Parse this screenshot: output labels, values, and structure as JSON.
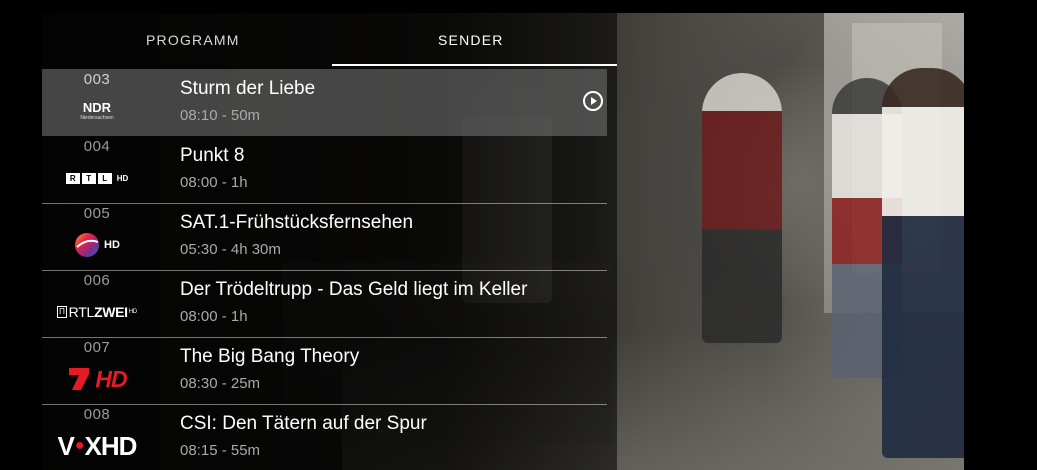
{
  "tabs": {
    "programm": "PROGRAMM",
    "sender": "SENDER",
    "active": "SENDER"
  },
  "channels": [
    {
      "number": "003",
      "logo": "NDR",
      "logo_sub": "Niedersachsen",
      "title": "Sturm der Liebe",
      "time": "08:10 - 50m",
      "selected": true
    },
    {
      "number": "004",
      "logo": "RTL",
      "logo_suffix": "HD",
      "title": "Punkt 8",
      "time": "08:00 - 1h",
      "selected": false
    },
    {
      "number": "005",
      "logo": "SAT.1",
      "logo_suffix": "HD",
      "title": "SAT.1-Frühstücksfernsehen",
      "time": "05:30 - 4h 30m",
      "selected": false
    },
    {
      "number": "006",
      "logo": "RTLZWEI",
      "logo_suffix": "HD",
      "title": "Der Trödeltrupp - Das Geld liegt im Keller",
      "time": "08:00 - 1h",
      "selected": false
    },
    {
      "number": "007",
      "logo": "7",
      "logo_suffix": "HD",
      "title": "The Big Bang Theory",
      "time": "08:30 - 25m",
      "selected": false
    },
    {
      "number": "008",
      "logo": "VOX",
      "logo_suffix": "HD",
      "title": "CSI: Den Tätern auf der Spur",
      "time": "08:15 - 55m",
      "selected": false
    }
  ],
  "colors": {
    "accent_red": "#e31b23",
    "selected_row": "#6e6e6e",
    "muted_text": "#a9a9a9"
  },
  "icons": {
    "play": "play-circle-icon"
  }
}
